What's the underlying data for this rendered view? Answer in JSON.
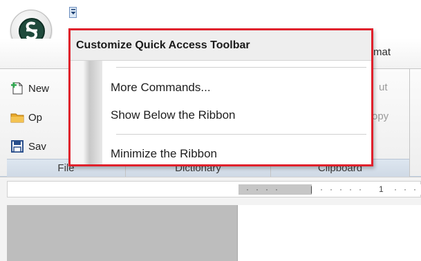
{
  "title_bar": {
    "qat_dropdown_icon": "dropdown-arrow-icon",
    "app_icon": "app-logo"
  },
  "tabs": {
    "partial_format_label": "rmat"
  },
  "ribbon": {
    "file_group": {
      "label": "File",
      "buttons": [
        {
          "label": "New",
          "icon": "new-document-icon"
        },
        {
          "label": "Op",
          "icon": "open-folder-icon"
        },
        {
          "label": "Sav",
          "icon": "save-icon"
        }
      ]
    },
    "dictionary_group": {
      "label": "Dictionary"
    },
    "clipboard_group": {
      "label": "Clipboard",
      "buttons": [
        {
          "label": "ut",
          "icon": "cut-icon"
        },
        {
          "label": "opy",
          "icon": "copy-icon"
        }
      ]
    }
  },
  "ruler": {
    "mark": "1"
  },
  "menu": {
    "header": "Customize Quick Access Toolbar",
    "items": [
      {
        "label": "More Commands..."
      },
      {
        "label": "Show Below the Ribbon"
      },
      {
        "label": "Minimize the Ribbon"
      }
    ],
    "highlight_color": "#e0202b"
  }
}
